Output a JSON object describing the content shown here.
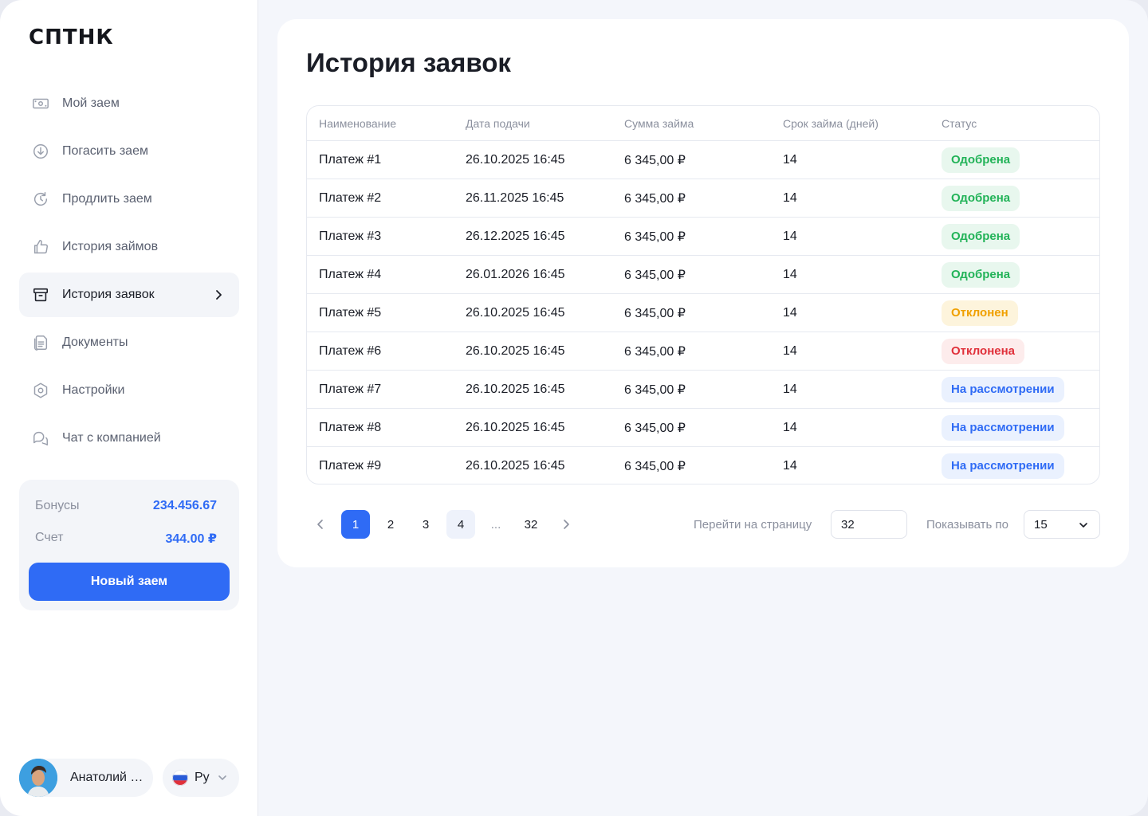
{
  "brand": {
    "logo": "СПТНК"
  },
  "sidebar": {
    "items": [
      {
        "label": "Мой заем",
        "icon": "money-icon"
      },
      {
        "label": "Погасить заем",
        "icon": "download-circle-icon"
      },
      {
        "label": "Продлить заем",
        "icon": "refresh-icon"
      },
      {
        "label": "История займов",
        "icon": "thumb-up-icon"
      },
      {
        "label": "История заявок",
        "icon": "archive-icon",
        "active": true
      },
      {
        "label": "Документы",
        "icon": "documents-icon"
      },
      {
        "label": "Настройки",
        "icon": "settings-icon"
      },
      {
        "label": "Чат с компанией",
        "icon": "chat-icon"
      }
    ],
    "balance": {
      "bonus_label": "Бонусы",
      "bonus_value": "234.456.67",
      "account_label": "Счет",
      "account_value": "344.00 ₽",
      "new_loan_button": "Новый заем"
    },
    "user": {
      "name": "Анатолий Петров"
    },
    "language": {
      "label": "Ру"
    }
  },
  "main": {
    "title": "История заявок",
    "table": {
      "headers": [
        "Наименование",
        "Дата подачи",
        "Сумма займа",
        "Срок займа (дней)",
        "Статус"
      ],
      "rows": [
        [
          "Платеж #1",
          "26.10.2025 16:45",
          "6 345,00 ₽",
          "14",
          "Одобрена"
        ],
        [
          "Платеж #2",
          "26.11.2025 16:45",
          "6 345,00 ₽",
          "14",
          "Одобрена"
        ],
        [
          "Платеж #3",
          "26.12.2025 16:45",
          "6 345,00 ₽",
          "14",
          "Одобрена"
        ],
        [
          "Платеж #4",
          "26.01.2026 16:45",
          "6 345,00 ₽",
          "14",
          "Одобрена"
        ],
        [
          "Платеж #5",
          "26.10.2025 16:45",
          "6 345,00 ₽",
          "14",
          "Отклонен"
        ],
        [
          "Платеж #6",
          "26.10.2025 16:45",
          "6 345,00 ₽",
          "14",
          "Отклонена"
        ],
        [
          "Платеж #7",
          "26.10.2025 16:45",
          "6 345,00 ₽",
          "14",
          "На рассмотрении"
        ],
        [
          "Платеж #8",
          "26.10.2025 16:45",
          "6 345,00 ₽",
          "14",
          "На рассмотрении"
        ],
        [
          "Платеж #9",
          "26.10.2025 16:45",
          "6 345,00 ₽",
          "14",
          "На рассмотрении"
        ]
      ],
      "status_types": [
        "ok",
        "ok",
        "ok",
        "ok",
        "warn",
        "bad",
        "review",
        "review",
        "review"
      ]
    },
    "pagination": {
      "pages": [
        "1",
        "2",
        "3",
        "4",
        "...",
        "32"
      ],
      "current": "1",
      "goto_label": "Перейти на страницу",
      "goto_value": "32",
      "per_page_label": "Показывать по",
      "per_page_value": "15"
    }
  },
  "colors": {
    "accent": "#2f6bf5",
    "approved": "#22b358",
    "declined_warn": "#f0a000",
    "declined": "#e0303a"
  }
}
